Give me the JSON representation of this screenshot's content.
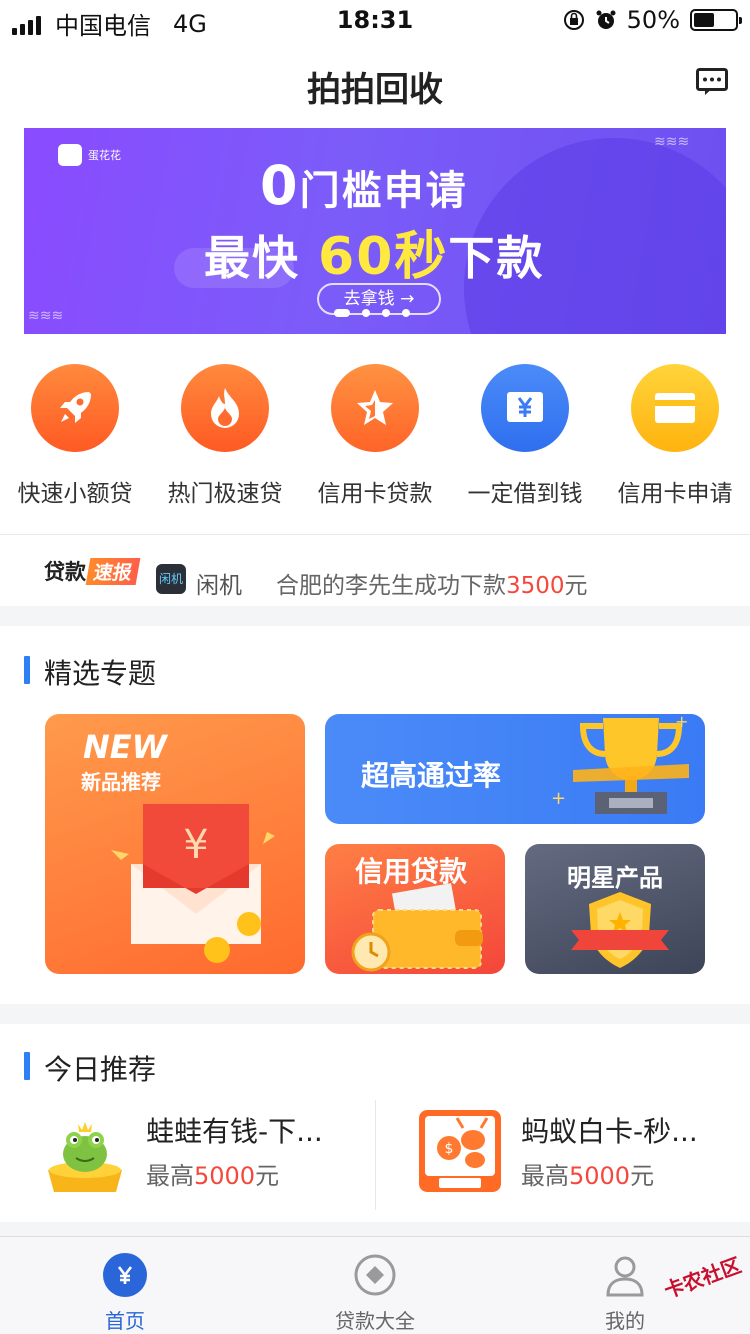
{
  "status_bar": {
    "carrier": "中国电信",
    "network": "4G",
    "time": "18:31",
    "battery": "50%",
    "battery_level": 0.5
  },
  "nav": {
    "title": "拍拍回收"
  },
  "banner": {
    "logo_text": "蛋花花",
    "line1_num": "0",
    "line1_text": "门槛申请",
    "line2_pre": "最快",
    "line2_highlight": "60秒",
    "line2_post": "下款",
    "cta": "去拿钱 →",
    "slide_count": 4,
    "active_slide": 1
  },
  "categories": [
    {
      "label": "快速小额贷",
      "icon": "rocket-icon",
      "color": "#ff6a2f"
    },
    {
      "label": "热门极速贷",
      "icon": "flame-icon",
      "color": "#ff6a2f"
    },
    {
      "label": "信用卡贷款",
      "icon": "star-icon",
      "color": "#ff7a33"
    },
    {
      "label": "一定借到钱",
      "icon": "yen-card-icon",
      "color": "#3b7cf4"
    },
    {
      "label": "信用卡申请",
      "icon": "credit-card-icon",
      "color": "#ffc21a"
    }
  ],
  "ticker": {
    "tag": "贷款",
    "tag_highlight": "速报",
    "app_icon_text": "闲机",
    "app_name": "闲机",
    "news_text": "合肥的李先生成功下款",
    "news_amount": "3500",
    "news_unit": "元"
  },
  "featured": {
    "title": "精选专题",
    "new_title": "NEW",
    "new_subtitle": "新品推荐",
    "rate_title": "超高通过率",
    "credit_title": "信用贷款",
    "star_title": "明星产品"
  },
  "today": {
    "title": "今日推荐",
    "items": [
      {
        "name": "蛙蛙有钱-下...",
        "limit_pre": "最高",
        "limit_amount": "5000",
        "limit_unit": "元",
        "logo_text": "蛙蛙有钱",
        "icon": "frog-logo-icon"
      },
      {
        "name": "蚂蚁白卡-秒...",
        "limit_pre": "最高",
        "limit_amount": "5000",
        "limit_unit": "元",
        "logo_text": "蚂蚁白卡",
        "icon": "ant-logo-icon"
      }
    ]
  },
  "tabbar": {
    "tabs": [
      {
        "label": "首页",
        "icon": "home-yen-icon",
        "active": true
      },
      {
        "label": "贷款大全",
        "icon": "loan-list-icon",
        "active": false
      },
      {
        "label": "我的",
        "icon": "user-icon",
        "active": false
      }
    ]
  },
  "watermark": "卡农社区",
  "colors": {
    "accent_blue": "#2e7ff6",
    "highlight_red": "#f5483d",
    "banner_purple": "#7b5cf9"
  }
}
